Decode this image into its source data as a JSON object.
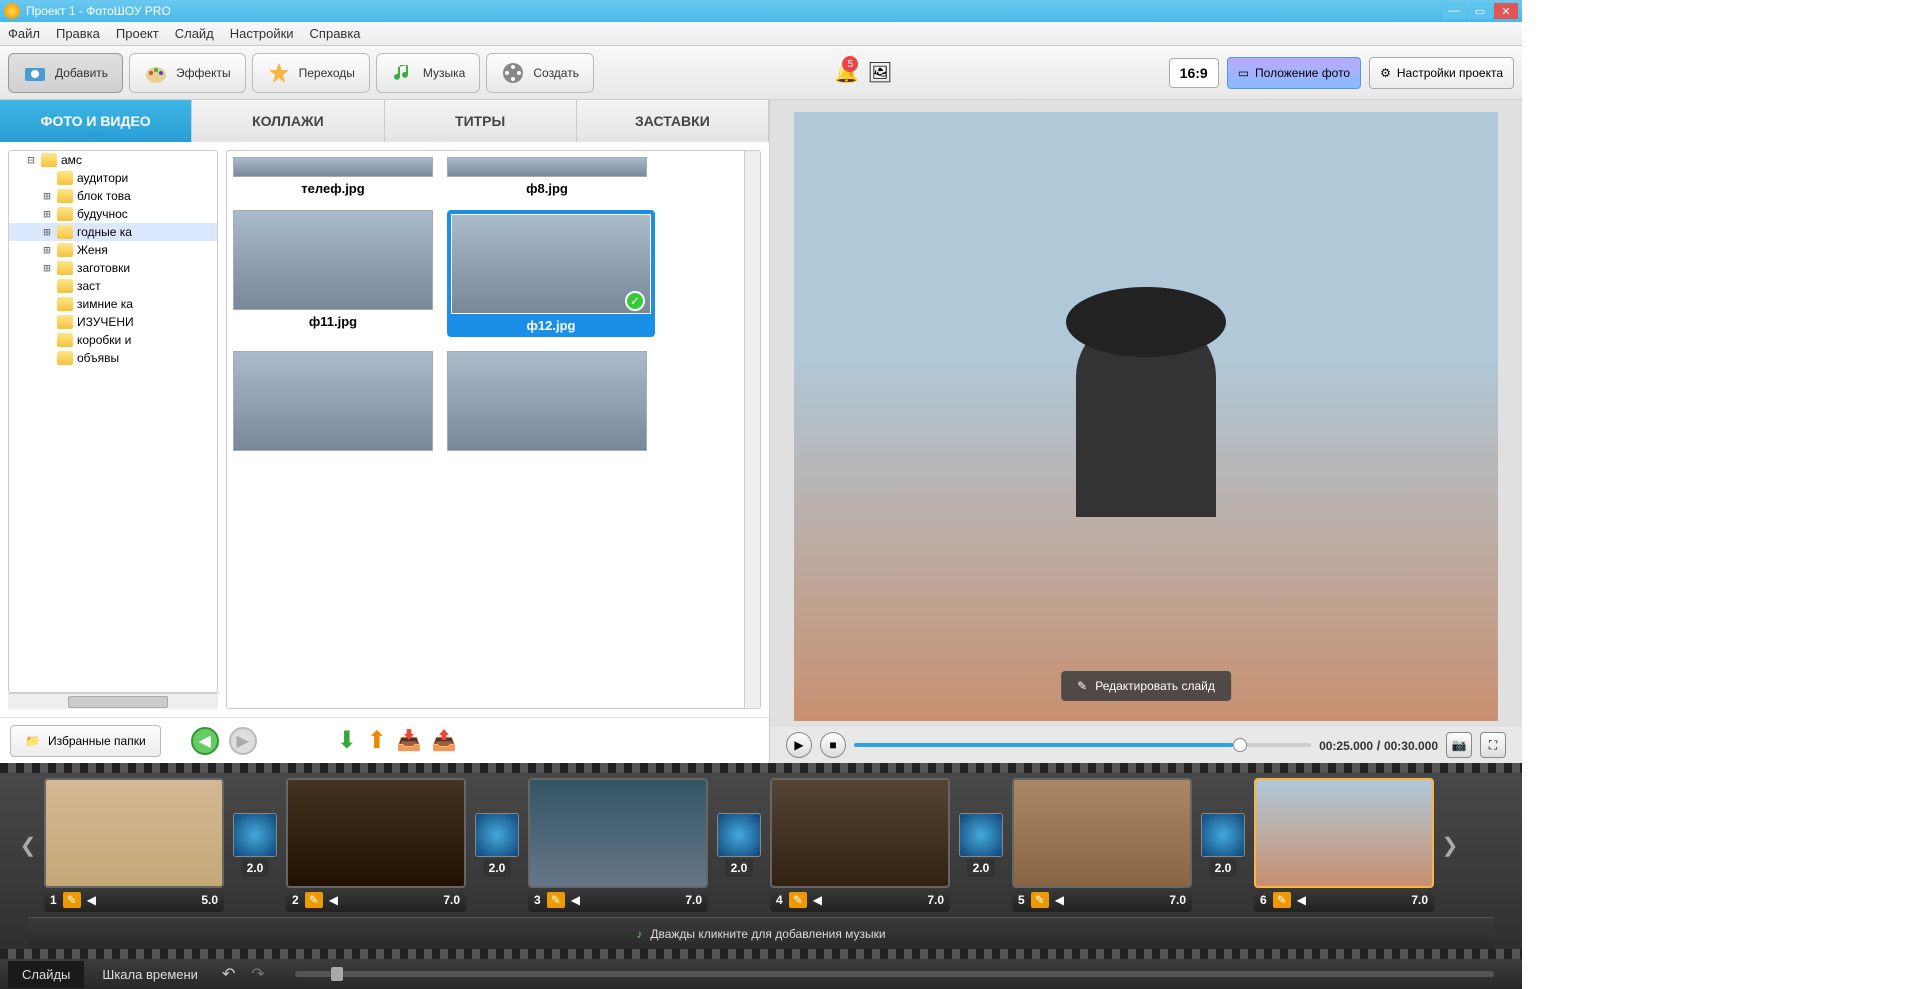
{
  "title": "Проект 1 - ФотоШОУ PRO",
  "menu": [
    "Файл",
    "Правка",
    "Проект",
    "Слайд",
    "Настройки",
    "Справка"
  ],
  "toolbar": {
    "add": "Добавить",
    "effects": "Эффекты",
    "transitions": "Переходы",
    "music": "Музыка",
    "create": "Создать",
    "aspect": "16:9",
    "photoPos": "Положение фото",
    "projSettings": "Настройки проекта",
    "notif": "5"
  },
  "subtabs": [
    "ФОТО И ВИДЕО",
    "КОЛЛАЖИ",
    "ТИТРЫ",
    "ЗАСТАВКИ"
  ],
  "tree": [
    {
      "lvl": 1,
      "exp": "⊟",
      "label": "амс"
    },
    {
      "lvl": 2,
      "exp": "",
      "label": "аудитори"
    },
    {
      "lvl": 2,
      "exp": "⊞",
      "label": "блок това"
    },
    {
      "lvl": 2,
      "exp": "⊞",
      "label": "будучнос"
    },
    {
      "lvl": 2,
      "exp": "⊞",
      "label": "годные ка",
      "sel": true
    },
    {
      "lvl": 2,
      "exp": "⊞",
      "label": "Женя"
    },
    {
      "lvl": 2,
      "exp": "⊞",
      "label": "заготовки"
    },
    {
      "lvl": 2,
      "exp": "",
      "label": "заст"
    },
    {
      "lvl": 2,
      "exp": "",
      "label": "зимние ка"
    },
    {
      "lvl": 2,
      "exp": "",
      "label": "ИЗУЧЕНИ"
    },
    {
      "lvl": 2,
      "exp": "",
      "label": "коробки и"
    },
    {
      "lvl": 2,
      "exp": "",
      "label": "объявы"
    }
  ],
  "thumbs": [
    {
      "name": "телеф.jpg",
      "first": true
    },
    {
      "name": "ф8.jpg",
      "first": true
    },
    {
      "name": "ф11.jpg"
    },
    {
      "name": "ф12.jpg",
      "sel": true
    },
    {
      "name": ""
    },
    {
      "name": ""
    }
  ],
  "fav": "Избранные папки",
  "editSlide": "Редактировать слайд",
  "time": {
    "cur": "00:25.000",
    "total": "00:30.000"
  },
  "slides": [
    {
      "n": "1",
      "dur": "5.0",
      "t": "2.0"
    },
    {
      "n": "2",
      "dur": "7.0",
      "t": "2.0"
    },
    {
      "n": "3",
      "dur": "7.0",
      "t": "2.0"
    },
    {
      "n": "4",
      "dur": "7.0",
      "t": "2.0"
    },
    {
      "n": "5",
      "dur": "7.0",
      "t": "2.0"
    },
    {
      "n": "6",
      "dur": "7.0",
      "sel": true
    }
  ],
  "musicHint": "Дважды кликните для добавления музыки",
  "btmTabs": [
    "Слайды",
    "Шкала времени"
  ]
}
